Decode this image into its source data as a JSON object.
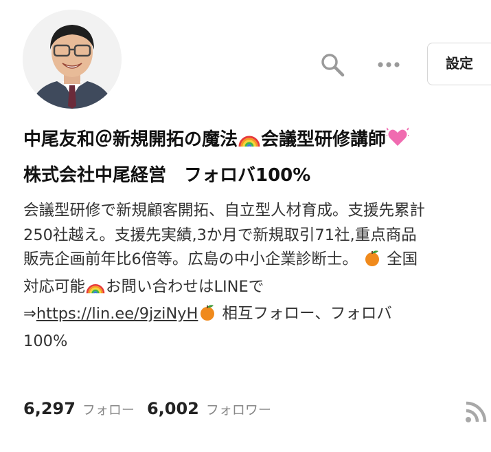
{
  "header": {
    "settings_label": "設定",
    "search_icon": "search-icon",
    "more_icon": "more-icon"
  },
  "profile": {
    "avatar_icon": "avatar",
    "name_line1_a": "中尾友和＠新規開拓の魔法",
    "name_line1_b": "会議型研修講師",
    "name_line2": "株式会社中尾経営　フォロバ100%",
    "emoji_rainbow": "rainbow-icon",
    "emoji_heart": "sparkling-heart-icon",
    "emoji_orange": "tangerine-icon"
  },
  "bio": {
    "line1": "会議型研修で新規顧客開拓、自立型人材育成。支援先累計",
    "line2": "250社越え。支援先実績,3か月で新規取引71社,重点商品",
    "line3_a": "販売企画前年比6倍等。広島の中小企業診断士。",
    "line3_b": "全国",
    "line4_a": "対応可能",
    "line4_b": "お問い合わせはLINEで",
    "line5_arrow": "⇒",
    "link_text": "https://lin.ee/9jziNyH",
    "line5_b": "相互フォロー、フォロバ",
    "line6": "100%"
  },
  "stats": {
    "following_count": "6,297",
    "following_label": "フォロー",
    "followers_count": "6,002",
    "followers_label": "フォロワー",
    "rss_icon": "rss-icon"
  },
  "colors": {
    "text": "#222222",
    "secondary": "#888888",
    "icon_gray": "#9a9a9a",
    "border": "#d6d6d6"
  }
}
